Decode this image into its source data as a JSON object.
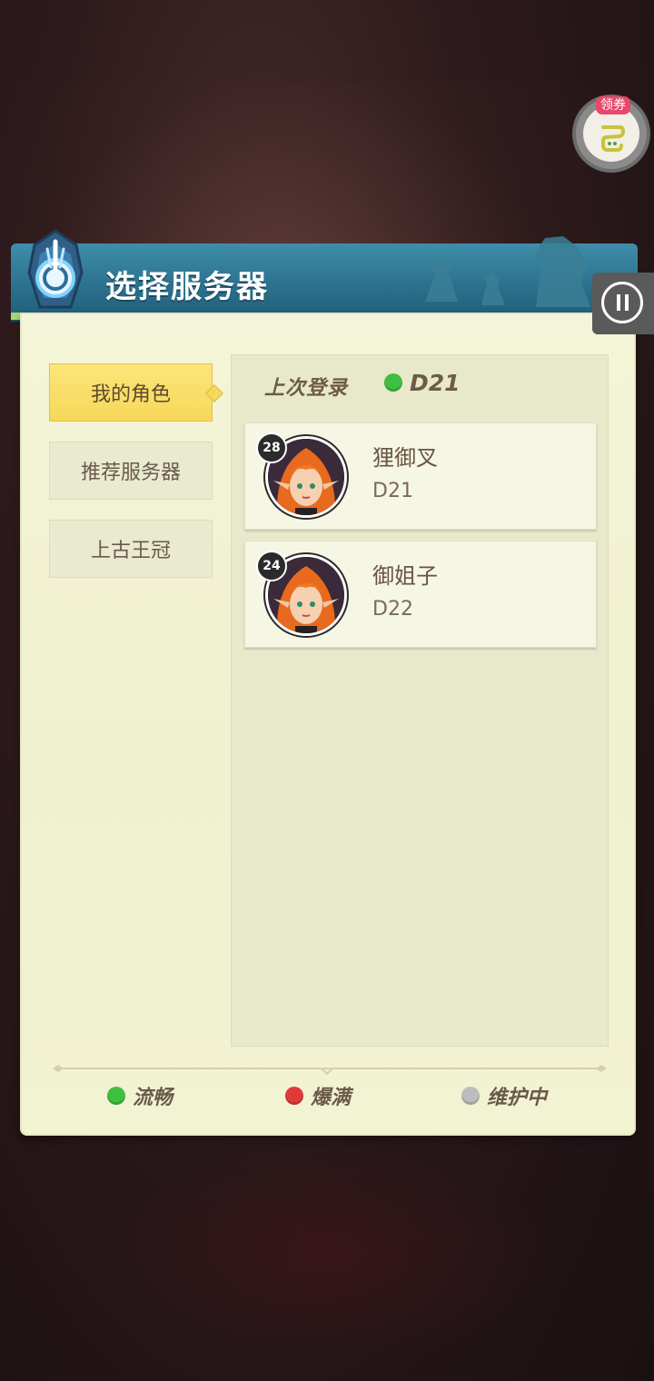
{
  "coupon": {
    "badge": "领券",
    "icon": "gamepad-icon"
  },
  "panel": {
    "title": "选择服务器"
  },
  "sidebar": {
    "items": [
      {
        "label": "我的角色",
        "active": true
      },
      {
        "label": "推荐服务器",
        "active": false
      },
      {
        "label": "上古王冠",
        "active": false
      }
    ]
  },
  "last_login": {
    "label": "上次登录",
    "server": "D21",
    "status_color": "#3fbf3f"
  },
  "roles": [
    {
      "level": "28",
      "name": "狸御叉",
      "server": "D21"
    },
    {
      "level": "24",
      "name": "御姐子",
      "server": "D22"
    }
  ],
  "legend": [
    {
      "label": "流畅",
      "color": "#3fbf3f"
    },
    {
      "label": "爆满",
      "color": "#e23a3a"
    },
    {
      "label": "维护中",
      "color": "#bdbdbd"
    }
  ],
  "colors": {
    "header_blue": "#2a6f8c",
    "parchment": "#f4f4d8",
    "active_tab": "#f6d85a"
  }
}
